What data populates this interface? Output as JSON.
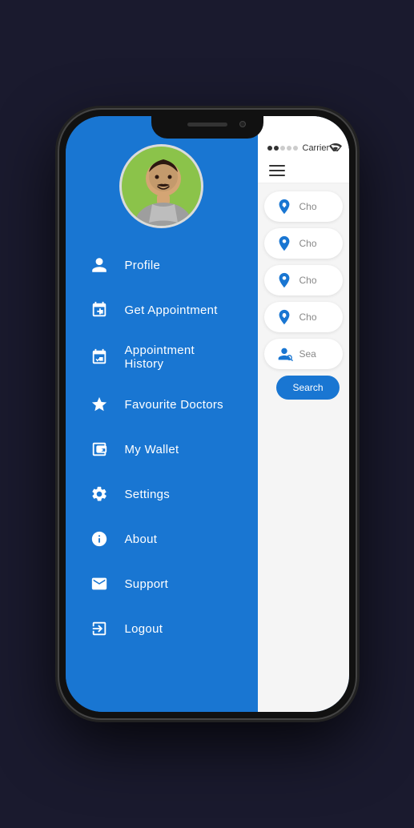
{
  "phone": {
    "status_bar": {
      "signal": "●●○○○",
      "carrier": "Carrier",
      "wifi_icon": "wifi"
    },
    "hamburger_label": "≡"
  },
  "drawer": {
    "avatar_alt": "User profile photo",
    "menu_items": [
      {
        "id": "profile",
        "icon": "person",
        "label": "Profile"
      },
      {
        "id": "get-appointment",
        "icon": "calendar-plus",
        "label": "Get Appointment"
      },
      {
        "id": "appointment-history",
        "icon": "calendar-check",
        "label": "Appointment History"
      },
      {
        "id": "favourite-doctors",
        "icon": "star",
        "label": "Favourite Doctors"
      },
      {
        "id": "my-wallet",
        "icon": "wallet",
        "label": "My Wallet"
      },
      {
        "id": "settings",
        "icon": "gear",
        "label": "Settings"
      },
      {
        "id": "about",
        "icon": "info",
        "label": "About"
      },
      {
        "id": "support",
        "icon": "envelope",
        "label": "Support"
      },
      {
        "id": "logout",
        "icon": "logout",
        "label": "Logout"
      }
    ]
  },
  "content": {
    "rows": [
      {
        "id": "row1",
        "icon": "location-medical",
        "placeholder": "Cho"
      },
      {
        "id": "row2",
        "icon": "location-pin",
        "placeholder": "Cho"
      },
      {
        "id": "row3",
        "icon": "location-pin",
        "placeholder": "Cho"
      },
      {
        "id": "row4",
        "icon": "location-medical",
        "placeholder": "Cho"
      },
      {
        "id": "row5",
        "icon": "search-person",
        "placeholder": "Sea"
      }
    ],
    "search_button_label": "Search"
  }
}
